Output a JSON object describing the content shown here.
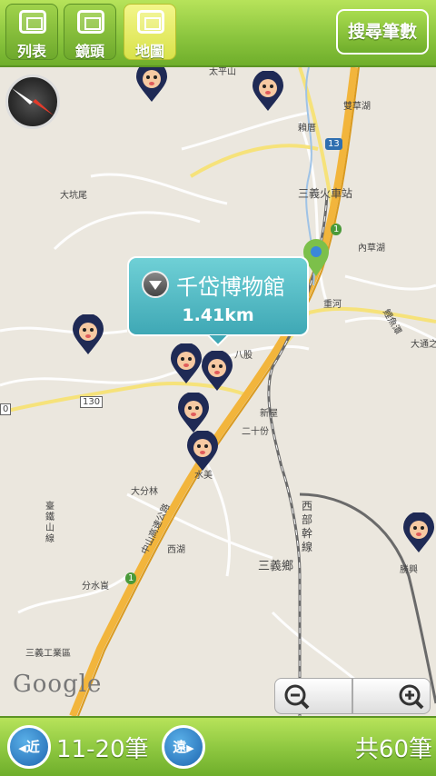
{
  "tabs": [
    {
      "label": "列表",
      "active": false
    },
    {
      "label": "鏡頭",
      "active": false
    },
    {
      "label": "地圖",
      "active": true
    }
  ],
  "search_count_button": "搜尋筆數",
  "map": {
    "place_labels": [
      "太平山",
      "雙草湖",
      "賴厝",
      "三義火車站",
      "大坑尾",
      "內草湖",
      "重河",
      "八股",
      "鯉魚潭",
      "大通之",
      "130",
      "0",
      "新屋",
      "二十份",
      "大分林",
      "水美",
      "西湖",
      "三義鄉",
      "西部幹線",
      "勝興",
      "分水崀",
      "三義工業區",
      "臺鐵山線",
      "中山高速公路"
    ],
    "road_markers": [
      "13",
      "1",
      "1",
      "130"
    ],
    "popup": {
      "title": "千岱博物館",
      "distance": "1.41km"
    },
    "attribution": "Google",
    "colors": {
      "highway": "#f2b53c",
      "rail": "#6a6a6a",
      "popup": "#4fb9c2"
    }
  },
  "bottom": {
    "prev_button": "近",
    "next_button": "遠",
    "range": "11-20筆",
    "total": "共60筆"
  }
}
